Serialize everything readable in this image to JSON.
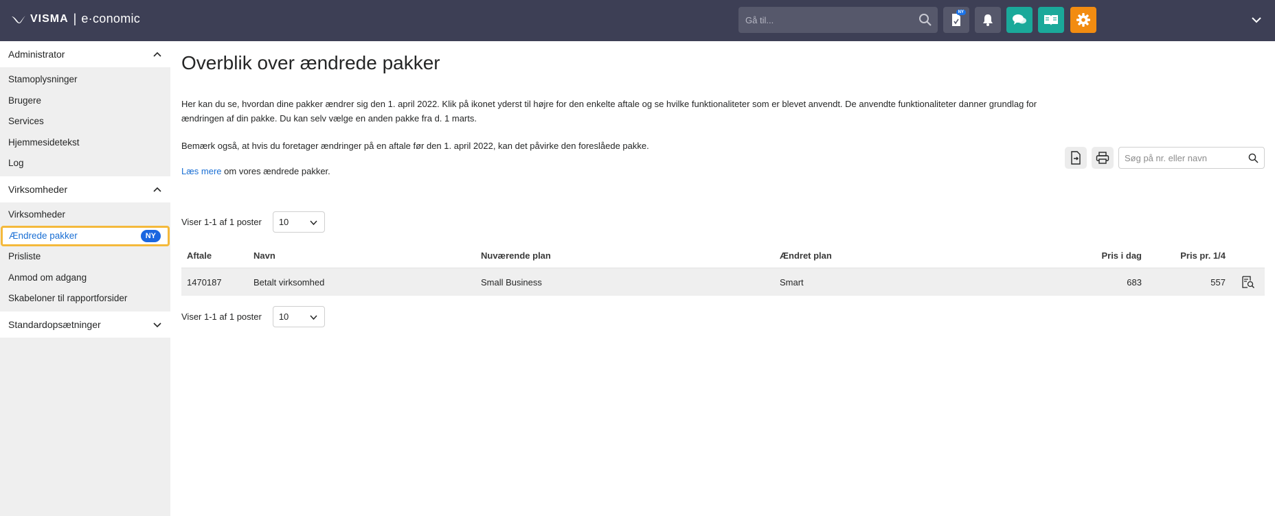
{
  "header": {
    "brand": "VISMA",
    "separator": "|",
    "product": "e·conomic",
    "search_placeholder": "Gå til...",
    "new_badge": "NY"
  },
  "sidebar": {
    "sections": [
      {
        "label": "Administrator",
        "items": [
          "Stamoplysninger",
          "Brugere",
          "Services",
          "Hjemmesidetekst",
          "Log"
        ]
      },
      {
        "label": "Virksomheder",
        "items": [
          "Virksomheder",
          "Ændrede pakker",
          "Prisliste",
          "Anmod om adgang",
          "Skabeloner til rapportforsider"
        ]
      },
      {
        "label": "Standardopsætninger",
        "items": []
      }
    ],
    "active_badge": "NY"
  },
  "main": {
    "title": "Overblik over ændrede pakker",
    "intro": "Her kan du se, hvordan dine pakker ændrer sig den 1. april 2022. Klik på ikonet yderst til højre for den enkelte aftale og se hvilke funktionaliteter som er blevet anvendt. De anvendte funktionaliteter danner grundlag for ændringen af din pakke. Du kan selv vælge en anden pakke fra d. 1 marts.",
    "note": "Bemærk også, at hvis du foretager ændringer på en aftale før den 1. april 2022, kan det påvirke den foreslåede pakke.",
    "read_more_link": "Læs mere",
    "read_more_rest": " om vores ændrede pakker.",
    "search_placeholder": "Søg på nr. eller navn",
    "pager_text": "Viser 1-1 af 1 poster",
    "page_size": "10",
    "table": {
      "headers": [
        "Aftale",
        "Navn",
        "Nuværende plan",
        "Ændret plan",
        "Pris i dag",
        "Pris pr. 1/4"
      ],
      "rows": [
        [
          "1470187",
          "Betalt virksomhed",
          "Small Business",
          "Smart",
          "683",
          "557"
        ]
      ]
    }
  }
}
